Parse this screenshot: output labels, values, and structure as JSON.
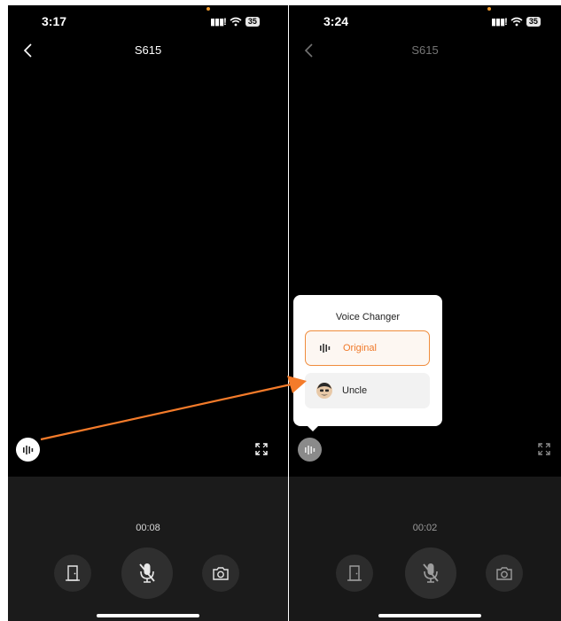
{
  "left_screen": {
    "status_time": "3:17",
    "battery": "35",
    "title": "S615",
    "call_timer": "00:08"
  },
  "right_screen": {
    "status_time": "3:24",
    "battery": "35",
    "title": "S615",
    "call_timer": "00:02",
    "voice_changer": {
      "title": "Voice Changer",
      "options": [
        {
          "label": "Original",
          "selected": true,
          "icon": "sound-wave-icon"
        },
        {
          "label": "Uncle",
          "selected": false,
          "icon": "uncle-avatar-icon"
        }
      ]
    }
  },
  "colors": {
    "accent": "#f07a2a",
    "annotation_arrow": "#f47b2a",
    "background": "#000000",
    "panel": "#1b1b1b"
  },
  "icons": {
    "back": "chevron-left-icon",
    "voice": "sound-wave-icon",
    "fullscreen": "fullscreen-icon",
    "door": "door-icon",
    "mic": "mic-off-icon",
    "camera": "camera-icon"
  }
}
